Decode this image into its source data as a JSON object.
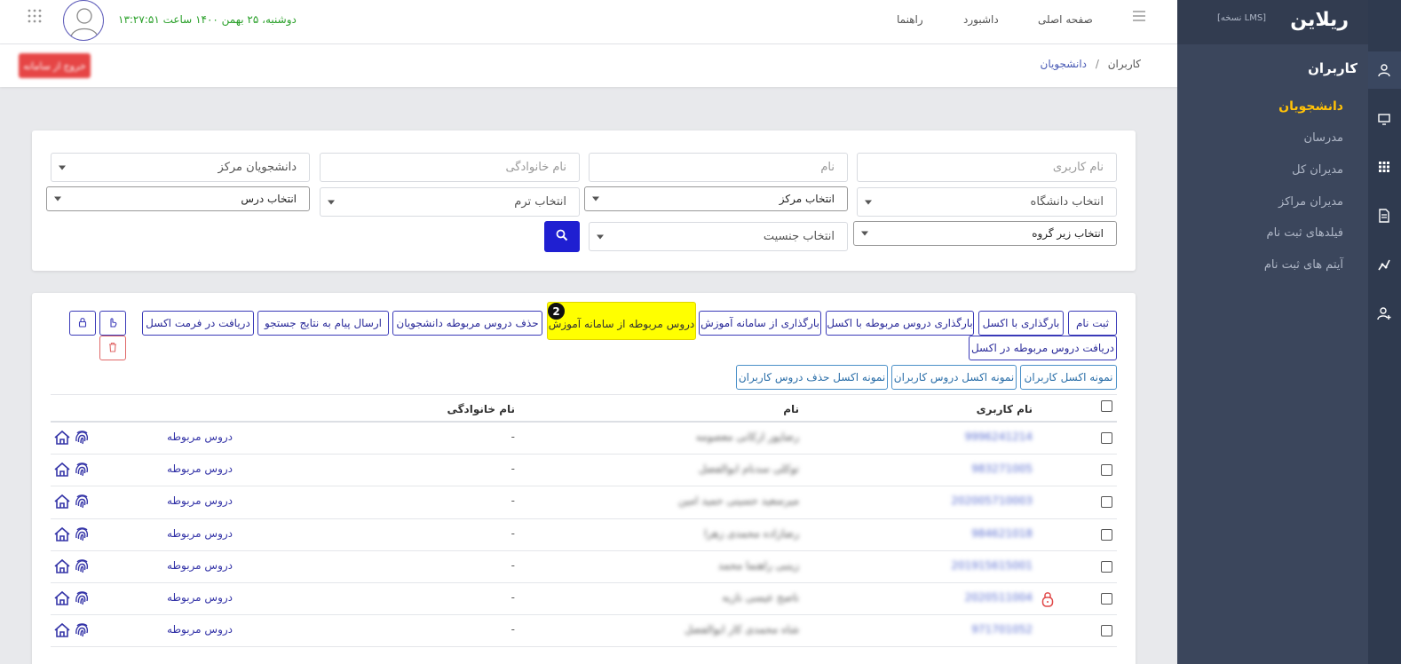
{
  "app": {
    "logo_text": "ریلاین",
    "version_label": "[نسخه LMS]"
  },
  "sidebar": {
    "heading": "کاربران",
    "items": [
      {
        "label": "دانشجویان",
        "active": true
      },
      {
        "label": "مدرسان"
      },
      {
        "label": "مدیران کل"
      },
      {
        "label": "مدیران مراکز"
      },
      {
        "label": "فیلدهای ثبت نام"
      },
      {
        "label": "آیتم های ثبت نام"
      }
    ],
    "rail_icons": [
      "users-icon",
      "monitor-icon",
      "grid-icon",
      "document-icon",
      "chart-icon",
      "user-add-icon"
    ]
  },
  "topbar": {
    "nav": [
      "صفحه اصلی",
      "داشبورد",
      "راهنما"
    ],
    "datetime": "دوشنبه، ۲۵ بهمن ۱۴۰۰ ساعت ۱۳:۲۷:۵۱"
  },
  "breadcrumb": {
    "parent": "کاربران",
    "separator": "/",
    "current": "دانشجویان",
    "logout_label": "خروج از سامانه"
  },
  "filters": {
    "username_placeholder": "نام کاربری",
    "name_placeholder": "نام",
    "family_placeholder": "نام خانوادگی",
    "center_students": "دانشجویان مرکز",
    "university": "انتخاب دانشگاه",
    "center": "انتخاب مرکز",
    "term": "انتخاب ترم",
    "course": "انتخاب درس",
    "subgroup": "انتخاب زیر گروه",
    "gender": "انتخاب جنسیت"
  },
  "actions": {
    "row1": [
      "ثبت نام",
      "بارگذاری با اکسل",
      "بارگذاری دروس مربوطه با اکسل",
      "بارگذاری از سامانه آموزش",
      "دروس مربوطه از سامانه آموزش",
      "حذف دروس مربوطه دانشجویان",
      "ارسال پیام به نتایج جستجو",
      "دریافت در فرمت اکسل"
    ],
    "row2": [
      "دریافت دروس مربوطه در اکسل"
    ],
    "row3": [
      "نمونه اکسل کاربران",
      "نمونه اکسل دروس کاربران",
      "نمونه اکسل حذف دروس کاربران"
    ],
    "step_badge": "2",
    "highlight_color": "#ffff00"
  },
  "table": {
    "headers": {
      "username": "نام کاربری",
      "name": "نام",
      "family": "نام خانوادگی"
    },
    "rows": [
      {
        "username": "9996241214",
        "name": "رضاپور ارکانی معصومه",
        "family": "-",
        "link": "دروس مربوطه",
        "locked": false
      },
      {
        "username": "983271005",
        "name": "توکلی سدنام ابوالفضل",
        "family": "-",
        "link": "دروس مربوطه",
        "locked": false
      },
      {
        "username": "202005710003",
        "name": "میرسعید حسینی حمید امین",
        "family": "-",
        "link": "دروس مربوطه",
        "locked": false
      },
      {
        "username": "984621018",
        "name": "رضازاده محمدی زهرا",
        "family": "-",
        "link": "دروس مربوطه",
        "locked": false
      },
      {
        "username": "201915615001",
        "name": "زینبی راهنما محمد",
        "family": "-",
        "link": "دروس مربوطه",
        "locked": false
      },
      {
        "username": "2020511004",
        "name": "ناصح عیسی نازیه",
        "family": "-",
        "link": "دروس مربوطه",
        "locked": true
      },
      {
        "username": "971701052",
        "name": "شاه محمدی کار ابوالفضل",
        "family": "-",
        "link": "دروس مربوطه",
        "locked": false
      }
    ]
  },
  "colors": {
    "accent_yellow": "#ffc107",
    "primary_blue": "#1f1fd1",
    "danger_red": "#e64545",
    "sidebar_bg": "#3b465c"
  }
}
